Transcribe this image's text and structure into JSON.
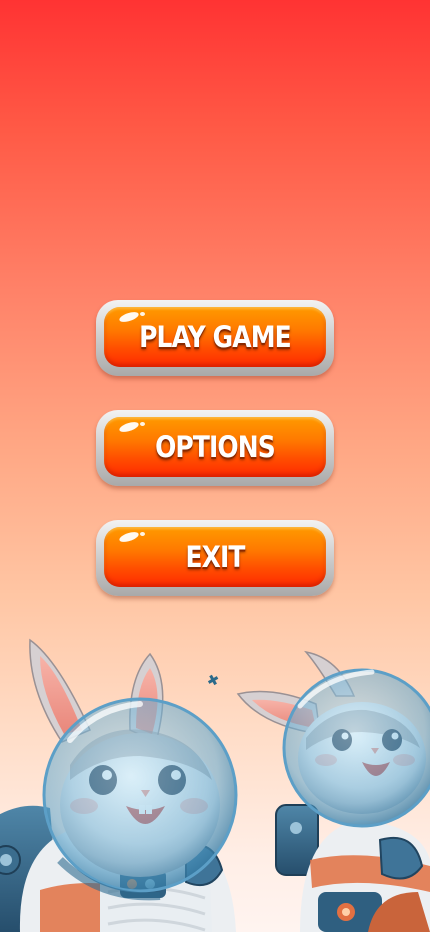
{
  "menu": {
    "buttons": [
      {
        "label": "PLAY GAME"
      },
      {
        "label": "OPTIONS"
      },
      {
        "label": "EXIT"
      }
    ]
  },
  "illustration": {
    "subject": "two cartoon bunnies in astronaut space suits",
    "icon": "bunny-astronaut-illustration"
  },
  "colors": {
    "background_top": "#ff3333",
    "background_bottom": "#fff4f0",
    "button_face_top": "#ff9a00",
    "button_face_bottom": "#ff2a00",
    "button_rim": "#c9c9c9",
    "label": "#ffffff"
  }
}
